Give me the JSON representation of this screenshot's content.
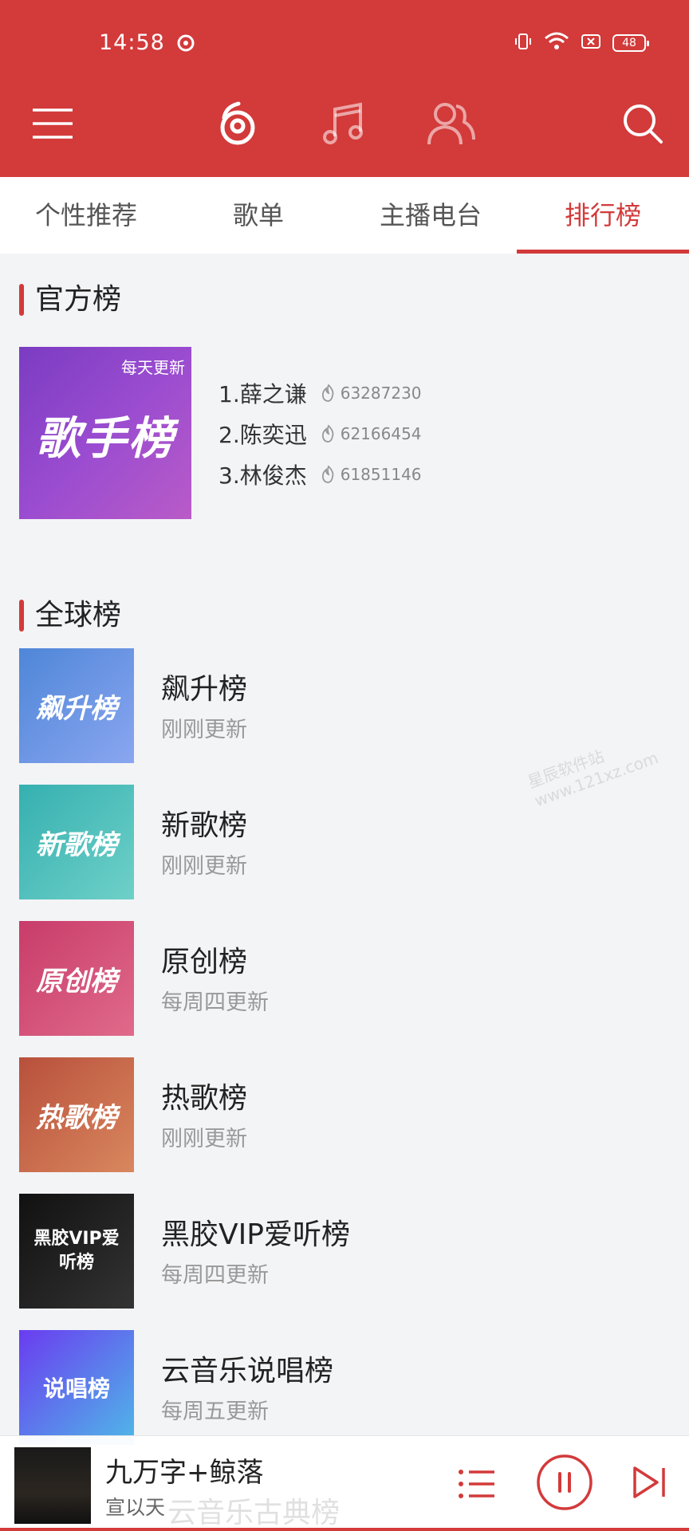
{
  "status_bar": {
    "time": "14:58",
    "battery": "48"
  },
  "tabs": [
    {
      "label": "个性推荐",
      "active": false
    },
    {
      "label": "歌单",
      "active": false
    },
    {
      "label": "主播电台",
      "active": false
    },
    {
      "label": "排行榜",
      "active": true
    }
  ],
  "official": {
    "title": "官方榜",
    "cover_badge": "每天更新",
    "cover_title": "歌手榜",
    "ranks": [
      {
        "name": "1.薛之谦",
        "hot": "63287230"
      },
      {
        "name": "2.陈奕迅",
        "hot": "62166454"
      },
      {
        "name": "3.林俊杰",
        "hot": "61851146"
      }
    ]
  },
  "global": {
    "title": "全球榜",
    "charts": [
      {
        "cover": "飙升榜",
        "name": "飙升榜",
        "update": "刚刚更新",
        "color": "#6a8fe0"
      },
      {
        "cover": "新歌榜",
        "name": "新歌榜",
        "update": "刚刚更新",
        "color": "#4bb8b8"
      },
      {
        "cover": "原创榜",
        "name": "原创榜",
        "update": "每周四更新",
        "color": "#d0507a"
      },
      {
        "cover": "热歌榜",
        "name": "热歌榜",
        "update": "刚刚更新",
        "color": "#c46a4e"
      },
      {
        "cover": "黑胶VIP爱听榜",
        "name": "黑胶VIP爱听榜",
        "update": "每周四更新",
        "color": "#1e1e1e"
      },
      {
        "cover": "说唱榜",
        "name": "云音乐说唱榜",
        "update": "每周五更新",
        "color": "#7d55e0"
      }
    ]
  },
  "ghost_text": "云音乐古典榜",
  "watermark": "星辰软件站 www.121xz.com",
  "player": {
    "title": "九万字+鲸落",
    "artist": "宣以天"
  },
  "colors": {
    "accent": "#d33a3a"
  }
}
